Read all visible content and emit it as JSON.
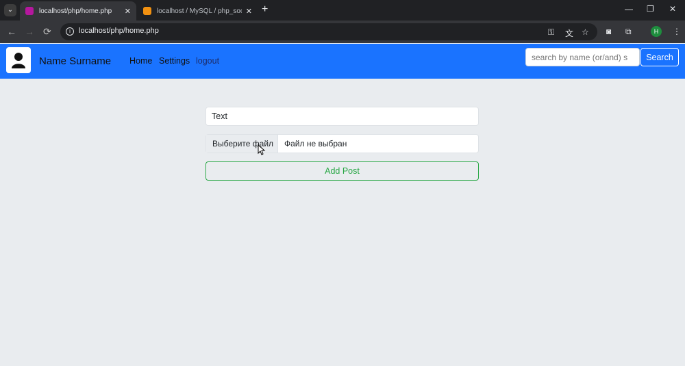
{
  "browser": {
    "tabs": [
      {
        "title": "localhost/php/home.php",
        "active": true,
        "favicon_color": "#b5179e"
      },
      {
        "title": "localhost / MySQL / php_social",
        "active": false,
        "favicon_color": "#f29111"
      }
    ],
    "url": "localhost/php/home.php",
    "profile_initial": "H"
  },
  "navbar": {
    "brand": "Name Surname",
    "links": [
      "Home",
      "Settings",
      "logout"
    ],
    "search_placeholder": "search by name (or/and) s",
    "search_button": "Search",
    "bg_color": "#1a73ff"
  },
  "form": {
    "text_value": "Text",
    "file_button": "Выберите файл",
    "file_status": "Файл не выбран",
    "submit_label": "Add Post"
  }
}
